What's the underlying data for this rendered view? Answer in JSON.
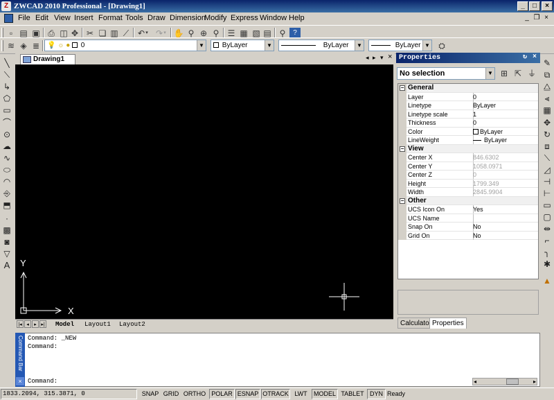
{
  "app": {
    "title": "ZWCAD 2010 Professional - [Drawing1]"
  },
  "menu": [
    "File",
    "Edit",
    "View",
    "Insert",
    "Format",
    "Tools",
    "Draw",
    "Dimension",
    "Modify",
    "Express",
    "Window",
    "Help"
  ],
  "layer_toolbar": {
    "layer_value": "0",
    "color_value": "ByLayer",
    "linetype_value": "ByLayer",
    "lineweight_value": "ByLayer"
  },
  "document": {
    "tab": "Drawing1"
  },
  "canvas": {
    "ucs_x": "X",
    "ucs_y": "Y"
  },
  "layout_tabs": [
    "Model",
    "Layout1",
    "Layout2"
  ],
  "properties": {
    "title": "Properties",
    "selection": "No selection",
    "groups": [
      {
        "name": "General",
        "rows": [
          {
            "key": "Layer",
            "value": "0",
            "readonly": false
          },
          {
            "key": "Linetype",
            "value": "ByLayer",
            "readonly": false
          },
          {
            "key": "Linetype scale",
            "value": "1",
            "readonly": false
          },
          {
            "key": "Thickness",
            "value": "0",
            "readonly": false
          },
          {
            "key": "Color",
            "value": "ByLayer",
            "readonly": false
          },
          {
            "key": "LineWeight",
            "value": "ByLayer",
            "readonly": false
          }
        ]
      },
      {
        "name": "View",
        "rows": [
          {
            "key": "Center X",
            "value": "846.6302",
            "readonly": true
          },
          {
            "key": "Center Y",
            "value": "1058.0971",
            "readonly": true
          },
          {
            "key": "Center Z",
            "value": "0",
            "readonly": true
          },
          {
            "key": "Height",
            "value": "1799.349",
            "readonly": true
          },
          {
            "key": "Width",
            "value": "2845.9904",
            "readonly": true
          }
        ]
      },
      {
        "name": "Other",
        "rows": [
          {
            "key": "UCS Icon On",
            "value": "Yes",
            "readonly": false
          },
          {
            "key": "UCS Name",
            "value": "",
            "readonly": false
          },
          {
            "key": "Snap On",
            "value": "No",
            "readonly": false
          },
          {
            "key": "Grid On",
            "value": "No",
            "readonly": false
          }
        ]
      }
    ],
    "tabs": [
      "Calculator",
      "Properties"
    ]
  },
  "command": {
    "side_label": "Command Bar",
    "history": [
      "Command: _NEW",
      "Command:"
    ],
    "prompt": "Command:"
  },
  "status": {
    "coords": "1833.2094,  315.3871, 0",
    "buttons": [
      "SNAP",
      "GRID",
      "ORTHO",
      "POLAR",
      "ESNAP",
      "OTRACK",
      "LWT",
      "MODEL",
      "TABLET",
      "DYN"
    ],
    "ready": "Ready"
  },
  "colors": {
    "title_bar": "#0a246a",
    "canvas": "#000000",
    "cmd_side": "#2458b4"
  }
}
